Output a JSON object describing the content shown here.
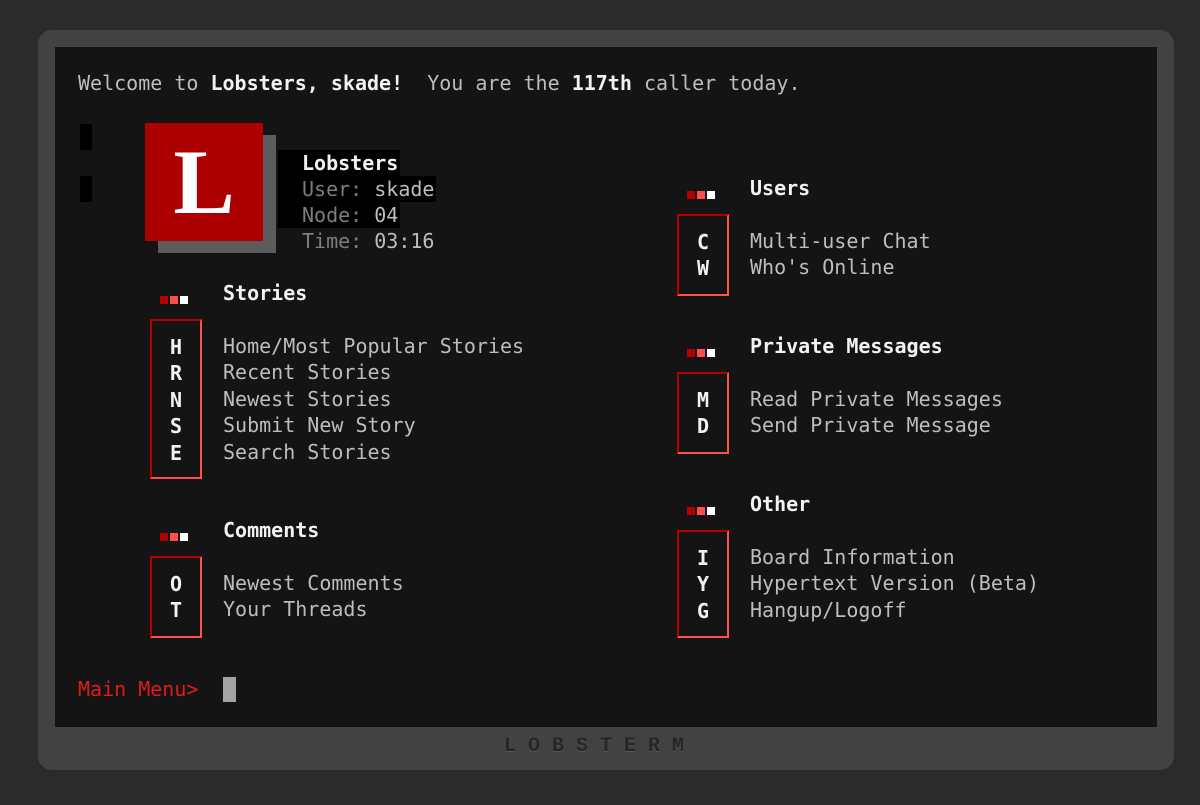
{
  "header": {
    "welcome_prefix": "Welcome to ",
    "bbs_name": "Lobsters, skade!",
    "middle": "  You are the ",
    "caller_count": "117th",
    "suffix": " caller today."
  },
  "logo": {
    "letter": "L"
  },
  "info": {
    "site": "Lobsters",
    "user_label": "User:",
    "user_value": "skade",
    "node_label": "Node:",
    "node_value": "04",
    "time_label": "Time:",
    "time_value": "03:16"
  },
  "sections": {
    "stories": {
      "title": "Stories",
      "keys": [
        "H",
        "R",
        "N",
        "S",
        "E"
      ],
      "items": [
        "Home/Most Popular Stories",
        "Recent Stories",
        "Newest Stories",
        "Submit New Story",
        "Search Stories"
      ]
    },
    "comments": {
      "title": "Comments",
      "keys": [
        "O",
        "T"
      ],
      "items": [
        "Newest Comments",
        "Your Threads"
      ]
    },
    "users": {
      "title": "Users",
      "keys": [
        "C",
        "W"
      ],
      "items": [
        "Multi-user Chat",
        "Who's Online"
      ]
    },
    "private": {
      "title": "Private Messages",
      "keys": [
        "M",
        "D"
      ],
      "items": [
        "Read Private Messages",
        "Send Private Message"
      ]
    },
    "other": {
      "title": "Other",
      "keys": [
        "I",
        "Y",
        "G"
      ],
      "items": [
        "Board Information",
        "Hypertext Version (Beta)",
        "Hangup/Logoff"
      ]
    }
  },
  "prompt": "Main Menu>",
  "brand": "LOBSTERM",
  "colors": {
    "accent_dark": "#b30000",
    "accent_light": "#ff4d4d",
    "logo_bg": "#ad0000",
    "screen_bg": "#141414",
    "prompt": "#e01b1b"
  }
}
